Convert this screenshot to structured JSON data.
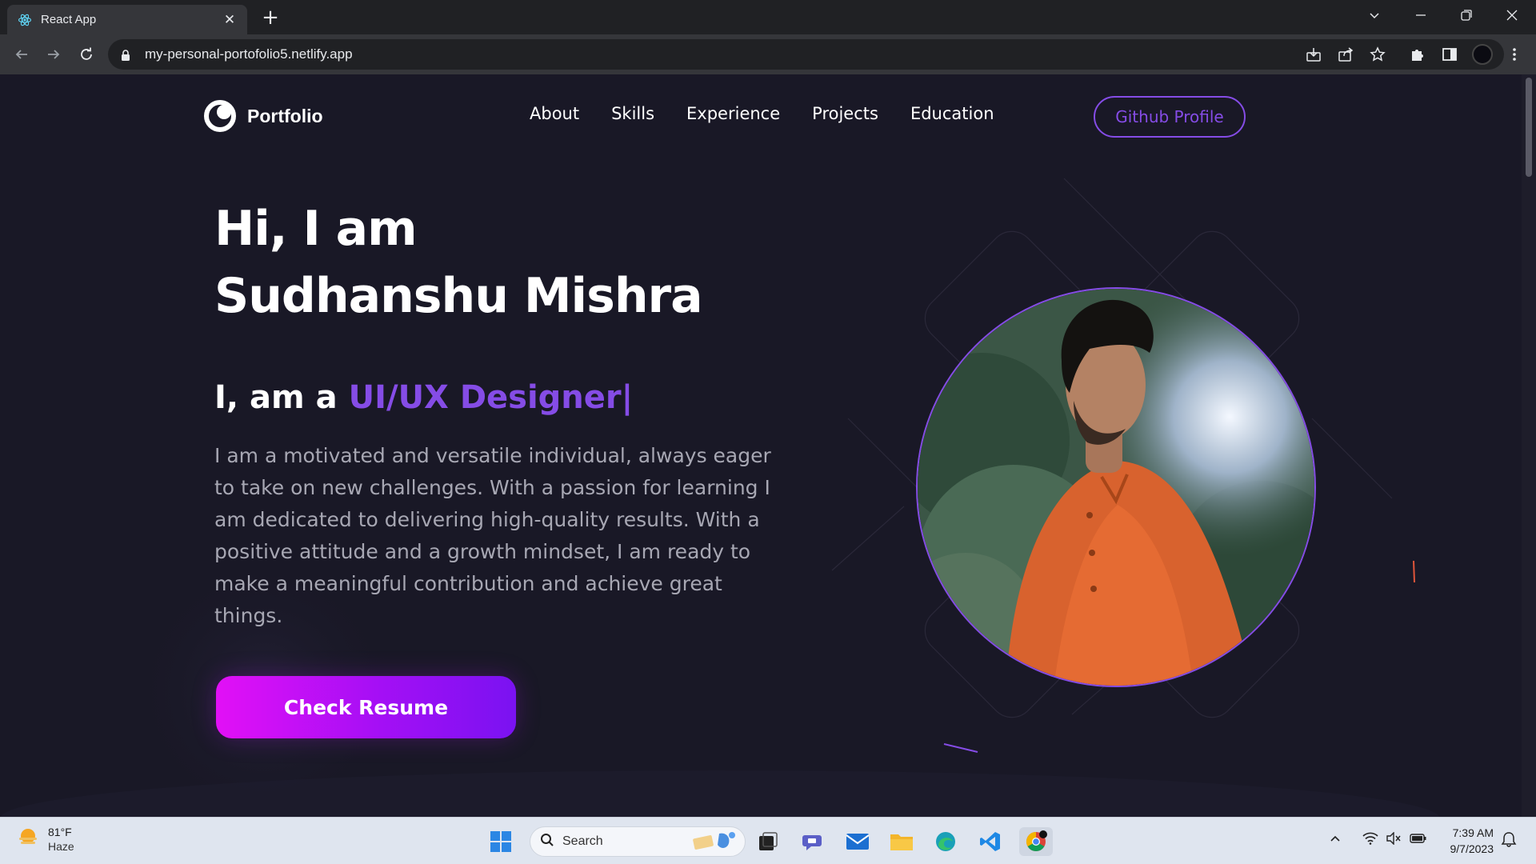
{
  "browser": {
    "tab_title": "React App",
    "url": "my-personal-portofolio5.netlify.app"
  },
  "site": {
    "brand": "Portfolio",
    "nav": [
      "About",
      "Skills",
      "Experience",
      "Projects",
      "Education"
    ],
    "github_button": "Github Profile",
    "hero": {
      "greeting": "Hi, I am",
      "name": "Sudhanshu Mishra",
      "role_prefix": "I, am a",
      "role": "UI/UX Designer|",
      "description": "I am a motivated and versatile individual, always eager to take on new challenges. With a passion for learning I am dedicated to delivering high-quality results. With a positive attitude and a growth mindset, I am ready to make a meaningful contribution and achieve great things.",
      "resume_button": "Check Resume"
    },
    "accent_color": "#854ce6",
    "background_color": "#191826"
  },
  "taskbar": {
    "weather_temp": "81°F",
    "weather_condition": "Haze",
    "search_label": "Search",
    "time": "7:39 AM",
    "date": "9/7/2023",
    "apps": [
      "windows-start",
      "search",
      "file-explorer-widget",
      "task-view",
      "teams-chat",
      "mail",
      "file-explorer",
      "edge",
      "vscode",
      "chrome"
    ]
  }
}
